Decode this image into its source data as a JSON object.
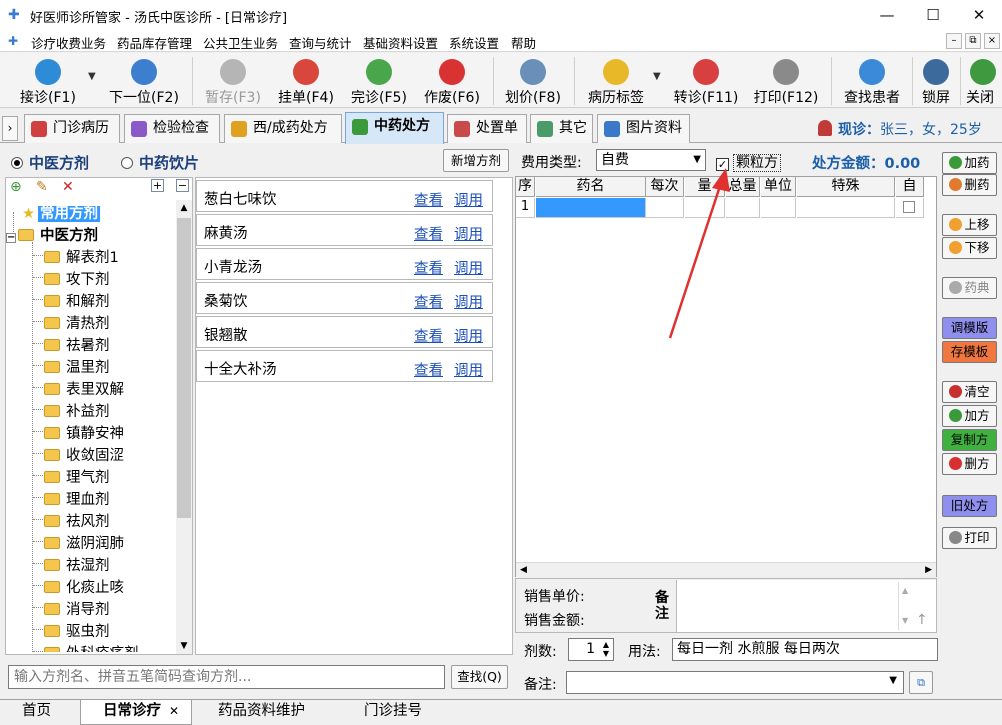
{
  "window": {
    "title": "好医师诊所管家 - 汤氏中医诊所 - [日常诊疗]",
    "minimize": "—",
    "maximize": "☐",
    "close": "✕"
  },
  "menu": {
    "items": [
      "诊疗收费业务",
      "药品库存管理",
      "公共卫生业务",
      "查询与统计",
      "基础资料设置",
      "系统设置",
      "帮助"
    ],
    "mdi_min": "–",
    "mdi_restore": "⧉",
    "mdi_close": "×"
  },
  "toolbar": {
    "items": [
      {
        "label": "接诊(F1)",
        "icon": "reception-icon",
        "color": "#2e8bd8"
      },
      {
        "label": "下一位(F2)",
        "icon": "next-patient-icon",
        "color": "#3c7fd0"
      },
      {
        "label": "暂存(F3)",
        "icon": "hold-icon",
        "color": "#b5b5b5"
      },
      {
        "label": "挂单(F4)",
        "icon": "hang-order-icon",
        "color": "#d9463b"
      },
      {
        "label": "完诊(F5)",
        "icon": "complete-icon",
        "color": "#4aa64a"
      },
      {
        "label": "作废(F6)",
        "icon": "void-icon",
        "color": "#d83232"
      },
      {
        "label": "划价(F8)",
        "icon": "calculator-icon",
        "color": "#6a8fb8"
      },
      {
        "label": "病历标签",
        "icon": "record-tag-icon",
        "color": "#e8b828"
      },
      {
        "label": "转诊(F11)",
        "icon": "referral-icon",
        "color": "#d84040"
      },
      {
        "label": "打印(F12)",
        "icon": "printer-icon",
        "color": "#8a8a8a"
      },
      {
        "label": "查找患者",
        "icon": "magnifier-icon",
        "color": "#3a8ad8"
      },
      {
        "label": "锁屏",
        "icon": "lock-screen-icon",
        "color": "#3c6a9c"
      },
      {
        "label": "关闭",
        "icon": "exit-icon",
        "color": "#3f9a3f"
      }
    ]
  },
  "tabs": {
    "items": [
      {
        "label": "门诊病历",
        "color": "#d04040"
      },
      {
        "label": "检验检查",
        "color": "#8a5bc8"
      },
      {
        "label": "西/成药处方",
        "color": "#e0a020"
      },
      {
        "label": "中药处方",
        "color": "#3c9a3c"
      },
      {
        "label": "处置单",
        "color": "#c84a4a"
      },
      {
        "label": "其它",
        "color": "#4a9a6a"
      },
      {
        "label": "图片资料",
        "color": "#3a78c8"
      }
    ],
    "active_index": 3
  },
  "patient": {
    "label": "现诊：",
    "value": "张三，女，25岁"
  },
  "left": {
    "radio_tcm": "中医方剂",
    "radio_herbs": "中药饮片",
    "new_formula": "新增方剂",
    "tree": {
      "favorites": "常用方剂",
      "root": "中医方剂",
      "children": [
        "解表剂1",
        "攻下剂",
        "和解剂",
        "清热剂",
        "祛暑剂",
        "温里剂",
        "表里双解",
        "补益剂",
        "镇静安神",
        "收敛固涩",
        "理气剂",
        "理血剂",
        "祛风剂",
        "滋阴润肺",
        "祛湿剂",
        "化痰止咳",
        "消导剂",
        "驱虫剂",
        "外科疮疡剂"
      ]
    },
    "formulas": [
      "葱白七味饮",
      "麻黄汤",
      "小青龙汤",
      "桑菊饮",
      "银翘散",
      "十全大补汤"
    ],
    "view_label": "查看",
    "use_label": "调用",
    "search_placeholder": "输入方剂名、拼音五笔简码查询方剂...",
    "find_button": "查找(Q)"
  },
  "prescription": {
    "fee_type_label": "费用类型:",
    "fee_type_value": "自费",
    "granule_label": "颗粒方",
    "granule_checked": true,
    "amount_label": "处方金额：",
    "amount_value": "0.00",
    "columns": [
      "序",
      "药名",
      "每次",
      "量",
      "总量",
      "单位",
      "特殊",
      "自"
    ],
    "rows": [
      {
        "seq": "1",
        "name": ""
      }
    ],
    "unit_price_label": "销售单价:",
    "sale_amount_label": "销售金额:",
    "note_vertical": "备注",
    "doses_label": "剂数:",
    "doses_value": "1",
    "usage_label": "用法:",
    "usage_value": "每日一剂 水煎服 每日两次",
    "remark_label": "备注:"
  },
  "right_buttons": [
    "加药",
    "删药",
    "上移",
    "下移",
    "药典",
    "调模版",
    "存模板",
    "清空",
    "加方",
    "复制方",
    "删方",
    "旧处方",
    "打印"
  ],
  "bottom_tabs": [
    "首页",
    "日常诊疗",
    "药品资料维护",
    "门诊挂号"
  ],
  "bottom_active": 1
}
